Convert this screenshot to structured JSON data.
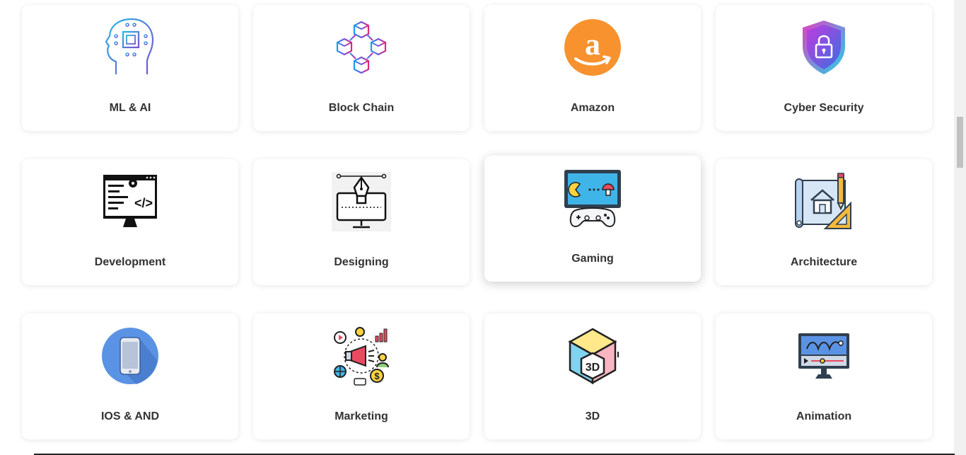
{
  "categories": [
    {
      "label": "ML & AI",
      "icon": "brain-chip-icon"
    },
    {
      "label": "Block Chain",
      "icon": "blockchain-cubes-icon"
    },
    {
      "label": "Amazon",
      "icon": "amazon-logo-icon"
    },
    {
      "label": "Cyber Security",
      "icon": "shield-lock-icon"
    },
    {
      "label": "Development",
      "icon": "code-monitor-icon"
    },
    {
      "label": "Designing",
      "icon": "pen-tool-monitor-icon"
    },
    {
      "label": "Gaming",
      "icon": "game-controller-icon"
    },
    {
      "label": "Architecture",
      "icon": "blueprint-house-icon"
    },
    {
      "label": "IOS & AND",
      "icon": "smartphone-icon"
    },
    {
      "label": "Marketing",
      "icon": "megaphone-marketing-icon"
    },
    {
      "label": "3D",
      "icon": "3d-cube-icon"
    },
    {
      "label": "Animation",
      "icon": "animation-timeline-icon"
    }
  ],
  "icon_texts": {
    "code": "</>",
    "three_d": "3D"
  },
  "colors": {
    "amazon_orange": "#f7922e",
    "shield_purple": "#b02ee0",
    "phone_blue": "#5b93e4"
  }
}
